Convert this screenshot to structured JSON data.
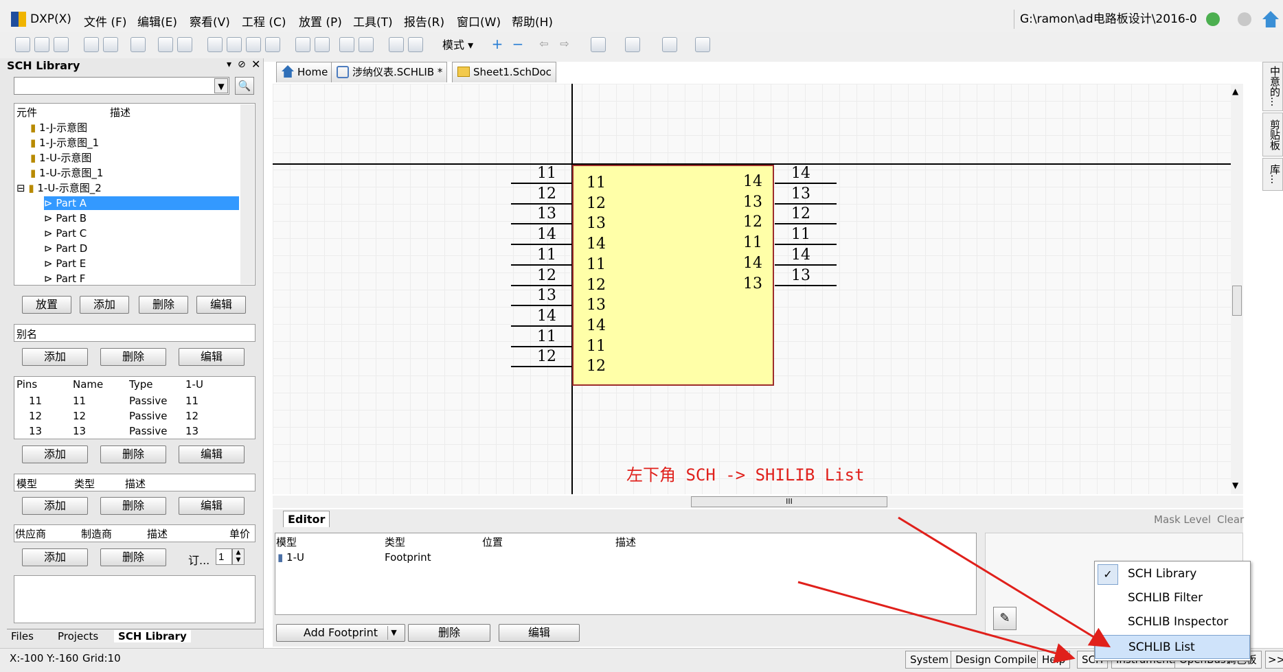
{
  "menu": {
    "items": [
      "DXP(X)",
      "文件 (F)",
      "编辑(E)",
      "察看(V)",
      "工程 (C)",
      "放置 (P)",
      "工具(T)",
      "报告(R)",
      "窗口(W)",
      "帮助(H)"
    ],
    "path": "G:\\ramon\\ad电路板设计\\2016-0"
  },
  "toolbar": {
    "mode_label": "模式"
  },
  "library_panel": {
    "title": "SCH Library",
    "search_value": "",
    "components_header": {
      "col1": "元件",
      "col2": "描述"
    },
    "components": [
      "1-J-示意图",
      "1-J-示意图_1",
      "1-U-示意图",
      "1-U-示意图_1",
      "1-U-示意图_2"
    ],
    "parts": [
      "Part A",
      "Part B",
      "Part C",
      "Part D",
      "Part E",
      "Part F"
    ],
    "component_buttons": [
      "放置",
      "添加",
      "删除",
      "编辑"
    ],
    "alias_header": "别名",
    "alias_buttons": [
      "添加",
      "删除",
      "编辑"
    ],
    "pins_header": [
      "Pins",
      "Name",
      "Type",
      "1-U"
    ],
    "pins": [
      {
        "pin": "11",
        "name": "11",
        "type": "Passive",
        "part": "11"
      },
      {
        "pin": "12",
        "name": "12",
        "type": "Passive",
        "part": "12"
      },
      {
        "pin": "13",
        "name": "13",
        "type": "Passive",
        "part": "13"
      }
    ],
    "pin_buttons": [
      "添加",
      "删除",
      "编辑"
    ],
    "model_header": [
      "模型",
      "类型",
      "描述"
    ],
    "model_buttons": [
      "添加",
      "删除",
      "编辑"
    ],
    "supplier_header": [
      "供应商",
      "制造商",
      "描述",
      "单价"
    ],
    "supplier_buttons": [
      "添加",
      "删除"
    ],
    "order_label": "订...",
    "order_qty": "1",
    "bottom_tabs": [
      "Files",
      "Projects",
      "SCH Library"
    ]
  },
  "doc_tabs": [
    {
      "label": "Home"
    },
    {
      "label": "涉纳仪表.SCHLIB *"
    },
    {
      "label": "Sheet1.SchDoc"
    }
  ],
  "schematic": {
    "left_pin_numbers": [
      "11",
      "12",
      "13",
      "14",
      "11",
      "12",
      "13",
      "14",
      "11",
      "12"
    ],
    "left_inner_labels": [
      "11",
      "12",
      "13",
      "14",
      "11",
      "12",
      "13",
      "14",
      "11",
      "12"
    ],
    "right_pin_numbers": [
      "14",
      "13",
      "12",
      "11",
      "14",
      "13"
    ],
    "right_inner_labels": [
      "14",
      "13",
      "12",
      "11",
      "14",
      "13"
    ],
    "body_color": "#ffffa8",
    "body_border": "#9c2b2b",
    "annotation": "左下角 SCH -> SHILIB List",
    "annotation_color": "#e0201b"
  },
  "scroll_label": "III",
  "editor": {
    "tab": "Editor",
    "mask_level": "Mask Level",
    "clear": "Clear",
    "columns": [
      "模型",
      "类型",
      "位置",
      "描述"
    ],
    "rows": [
      {
        "model": "1-U",
        "type": "Footprint",
        "position": "",
        "description": ""
      }
    ],
    "buttons": [
      "Add Footprint",
      "删除",
      "编辑"
    ]
  },
  "right_tabs": [
    "中意的...",
    "剪贴板",
    "库..."
  ],
  "status": {
    "coords": "X:-100 Y:-160",
    "grid": "Grid:10",
    "tabs": [
      "System",
      "Design Compiler",
      "Help",
      "SCH",
      "Instruments",
      "OpenBus调色板"
    ],
    "more": ">>"
  },
  "popup": {
    "items": [
      "SCH Library",
      "SCHLIB Filter",
      "SCHLIB Inspector",
      "SCHLIB List"
    ],
    "checked": "SCH Library",
    "highlighted": "SCHLIB List"
  }
}
